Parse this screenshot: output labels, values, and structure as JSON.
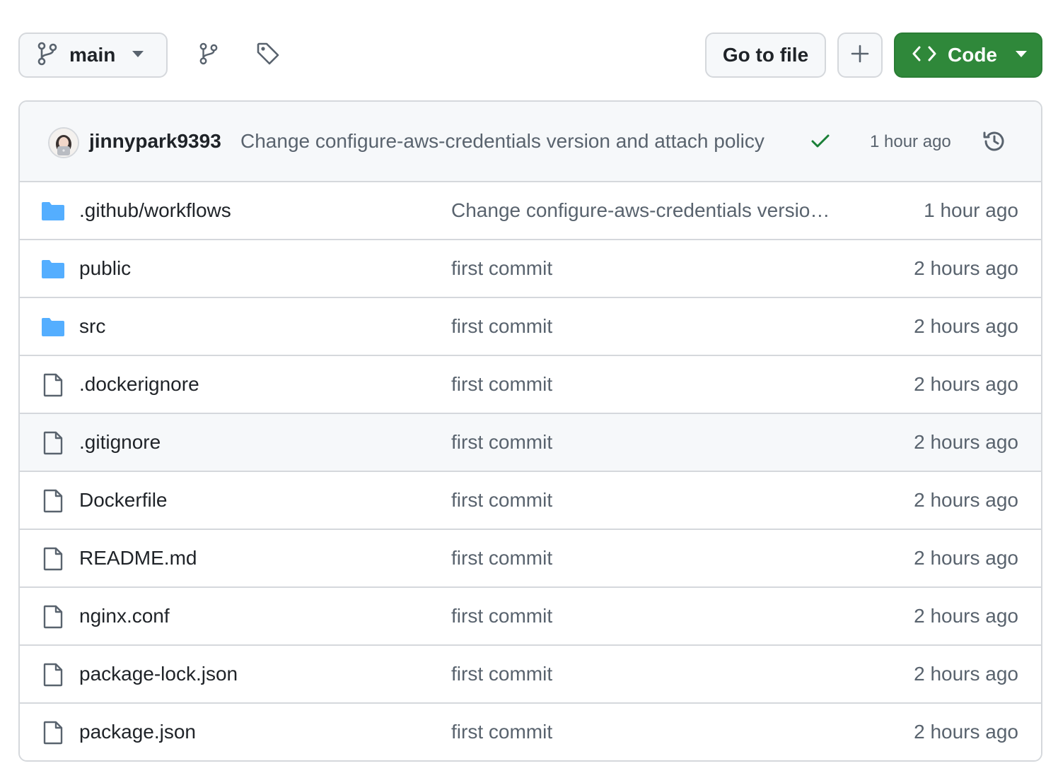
{
  "toolbar": {
    "branch_label": "main",
    "goto_file_label": "Go to file",
    "code_label": "Code",
    "icons": {
      "branch": "git-branch-icon",
      "branches": "git-branch-icon",
      "tags": "tag-icon",
      "add": "plus-icon",
      "code": "code-icon",
      "caret": "triangle-down-icon"
    }
  },
  "latest_commit": {
    "author": "jinnypark9393",
    "message": "Change configure-aws-credentials version and attach policy",
    "status": "success",
    "time": "1 hour ago",
    "icons": {
      "avatar": "avatar",
      "status": "check-icon",
      "history": "history-icon"
    }
  },
  "files": [
    {
      "type": "folder",
      "name": ".github/workflows",
      "message": "Change configure-aws-credentials versio…",
      "time": "1 hour ago"
    },
    {
      "type": "folder",
      "name": "public",
      "message": "first commit",
      "time": "2 hours ago"
    },
    {
      "type": "folder",
      "name": "src",
      "message": "first commit",
      "time": "2 hours ago"
    },
    {
      "type": "file",
      "name": ".dockerignore",
      "message": "first commit",
      "time": "2 hours ago"
    },
    {
      "type": "file",
      "name": ".gitignore",
      "message": "first commit",
      "time": "2 hours ago",
      "hover": true
    },
    {
      "type": "file",
      "name": "Dockerfile",
      "message": "first commit",
      "time": "2 hours ago"
    },
    {
      "type": "file",
      "name": "README.md",
      "message": "first commit",
      "time": "2 hours ago"
    },
    {
      "type": "file",
      "name": "nginx.conf",
      "message": "first commit",
      "time": "2 hours ago"
    },
    {
      "type": "file",
      "name": "package-lock.json",
      "message": "first commit",
      "time": "2 hours ago"
    },
    {
      "type": "file",
      "name": "package.json",
      "message": "first commit",
      "time": "2 hours ago"
    }
  ],
  "colors": {
    "code_button": "#2f883a",
    "folder": "#54aeff",
    "check": "#1a7f37",
    "muted_text": "#59636e",
    "border": "#d5d8dc"
  }
}
